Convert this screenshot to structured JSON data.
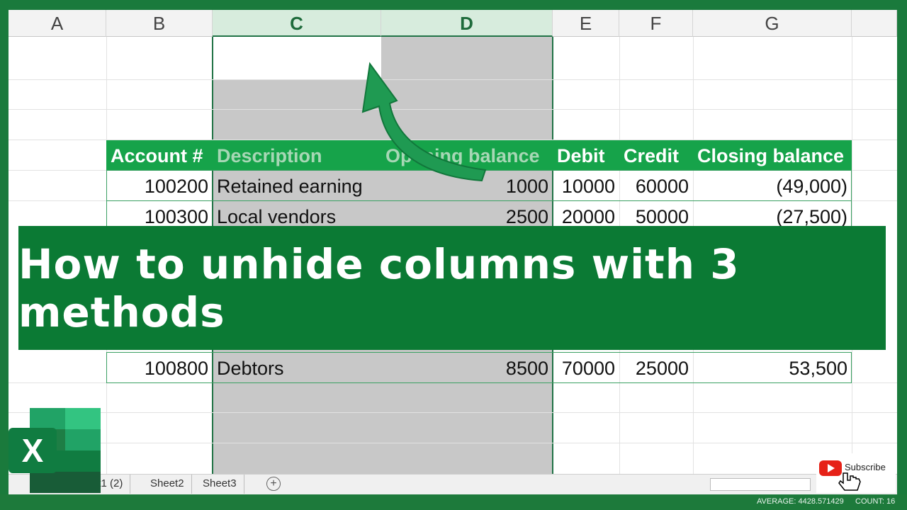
{
  "columns": [
    "A",
    "B",
    "C",
    "D",
    "E",
    "F",
    "G"
  ],
  "table": {
    "headers": [
      "Account #",
      "Description",
      "Opening balance",
      "Debit",
      "Credit",
      "Closing balance"
    ],
    "rows": [
      [
        "100200",
        "Retained earning",
        "1000",
        "10000",
        "60000",
        "(49,000)"
      ],
      [
        "100300",
        "Local vendors",
        "2500",
        "20000",
        "50000",
        "(27,500)"
      ],
      [
        "100800",
        "Debtors",
        "8500",
        "70000",
        "25000",
        "53,500"
      ]
    ]
  },
  "banner": {
    "title": "How to unhide columns with 3 methods"
  },
  "sheet_tabs": [
    "Sheet1 (2)",
    "Sheet2",
    "Sheet3"
  ],
  "sheet_tabs_partial": "et1 (2)",
  "add_sheet": "+",
  "status": {
    "average": "AVERAGE: 4428.571429",
    "count": "COUNT: 16"
  },
  "logo": {
    "letter": "X"
  },
  "youtube": {
    "label": "Subscribe"
  },
  "colors": {
    "frame": "#1a7a3c",
    "header_fill": "#16a34a",
    "banner": "#0b7a34",
    "hidden_cols": "#c8c8c8",
    "arrow": "#1f9a52"
  }
}
